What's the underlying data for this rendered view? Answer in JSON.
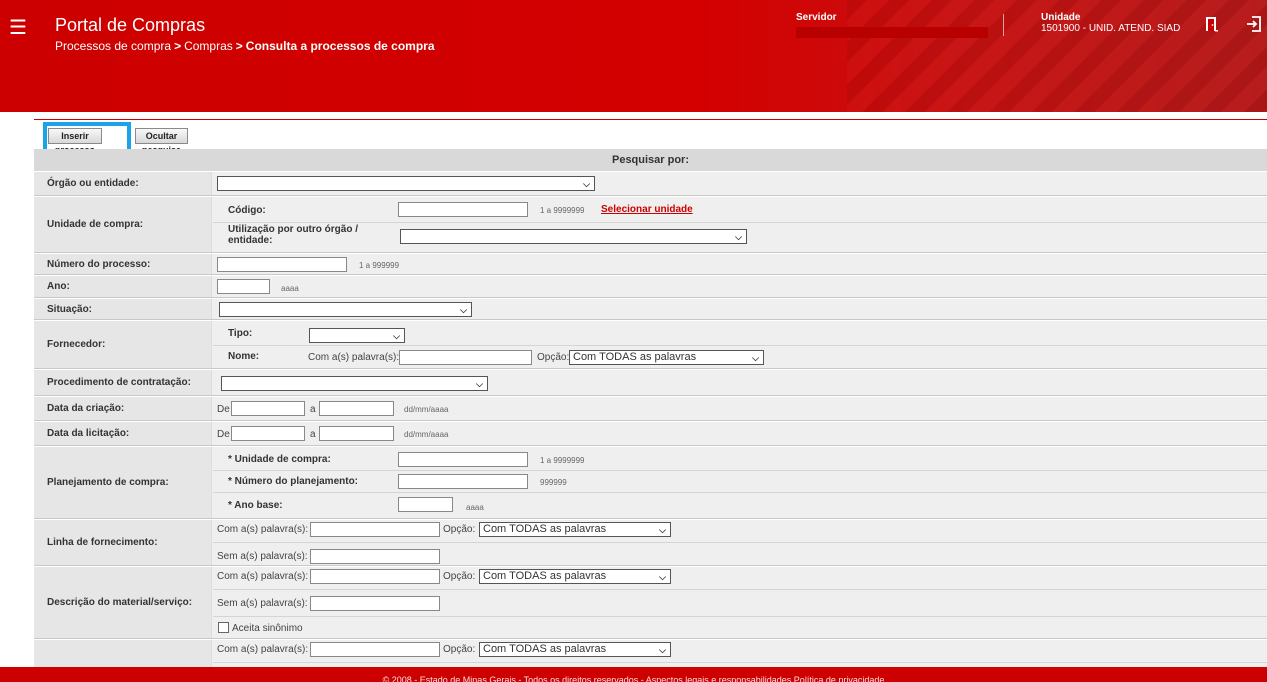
{
  "header": {
    "app_title": "Portal de Compras",
    "breadcrumb": [
      "Processos de compra",
      "Compras",
      "Consulta a processos de compra"
    ],
    "breadcrumb_sep": ">",
    "server_label": "Servidor",
    "unit_label": "Unidade",
    "unit_value": "1501900 - UNID. ATEND. SIAD",
    "icons": [
      "menu-icon",
      "door-icon",
      "exit-icon"
    ],
    "brand_color": "#cc0000"
  },
  "toolbar": {
    "insert_label": "Inserir processo",
    "hide_label": "Ocultar pesquisa"
  },
  "search": {
    "header": "Pesquisar por:",
    "orgao": {
      "label": "Órgão ou entidade:",
      "value": ""
    },
    "unidade": {
      "label": "Unidade de compra:",
      "codigo_label": "Código:",
      "codigo_hint": "1 a 9999999",
      "select_link": "Selecionar unidade",
      "outro_label": "Utilização por outro órgão / entidade:"
    },
    "numero": {
      "label": "Número do processo:",
      "hint": "1 a 999999"
    },
    "ano": {
      "label": "Ano:",
      "hint": "aaaa"
    },
    "situacao": {
      "label": "Situação:"
    },
    "fornecedor": {
      "label": "Fornecedor:",
      "tipo_label": "Tipo:",
      "nome_label": "Nome:",
      "com_label": "Com a(s) palavra(s):",
      "opcao_label": "Opção:",
      "opcao_value": "Com TODAS as palavras"
    },
    "procedimento": {
      "label": "Procedimento de contratação:"
    },
    "data_criacao": {
      "label": "Data da criação:",
      "de": "De",
      "a": "a",
      "hint": "dd/mm/aaaa"
    },
    "data_licitacao": {
      "label": "Data da licitação:",
      "de": "De",
      "a": "a",
      "hint": "dd/mm/aaaa"
    },
    "planejamento": {
      "label": "Planejamento de compra:",
      "unidade_label": "* Unidade de compra:",
      "unidade_hint": "1 a 9999999",
      "numero_label": "* Número do planejamento:",
      "numero_hint": "999999",
      "ano_label": "* Ano base:",
      "ano_hint": "aaaa"
    },
    "linha": {
      "label": "Linha de fornecimento:",
      "com_label": "Com a(s) palavra(s):",
      "opcao_label": "Opção:",
      "opcao_value": "Com TODAS as palavras",
      "sem_label": "Sem a(s) palavra(s):"
    },
    "descricao": {
      "label": "Descrição do material/serviço:",
      "com_label": "Com a(s) palavra(s):",
      "opcao_label": "Opção:",
      "opcao_value": "Com TODAS as palavras",
      "sem_label": "Sem a(s) palavra(s):",
      "sinonimo_label": "Aceita sinônimo"
    },
    "extra": {
      "com_label": "Com a(s) palavra(s):",
      "opcao_label": "Opção:",
      "opcao_value": "Com TODAS as palavras"
    }
  },
  "footer": {
    "text": "© 2008 - Estado de Minas Gerais - Todos os direitos reservados - Aspectos legais e responsabilidades Política de privacidade"
  }
}
